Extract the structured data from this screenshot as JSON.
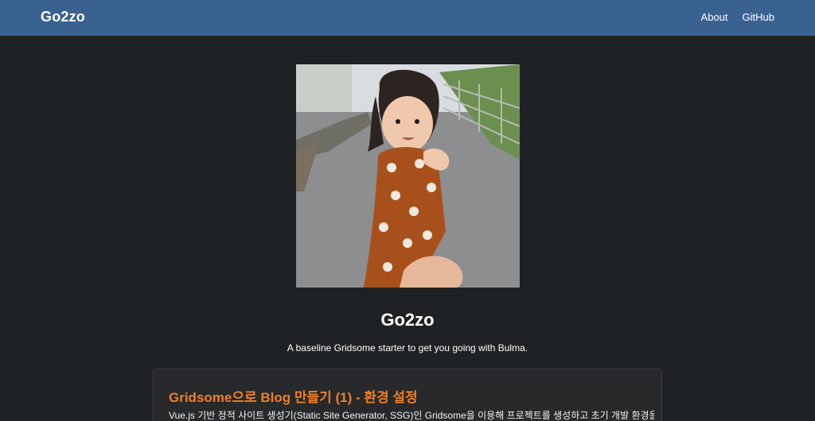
{
  "navbar": {
    "brand": "Go2zo",
    "links": [
      {
        "label": "About"
      },
      {
        "label": "GitHub"
      }
    ]
  },
  "hero": {
    "image_icon": "profile-photo",
    "title": "Go2zo",
    "description": "A baseline Gridsome starter to get you going with Bulma."
  },
  "posts": [
    {
      "title": "Gridsome으로 Blog 만들기 (1) - 환경 설정",
      "excerpt": "Vue.js 기반 정적 사이트 생성기(Static Site Generator, SSG)인 Gridsome을 이용해 프로젝트를 생성하고 초기 개발 환경을"
    }
  ],
  "colors": {
    "navbar": "#3a6291",
    "background": "#1f2224",
    "accent": "#f07f22",
    "card": "#27292b"
  }
}
